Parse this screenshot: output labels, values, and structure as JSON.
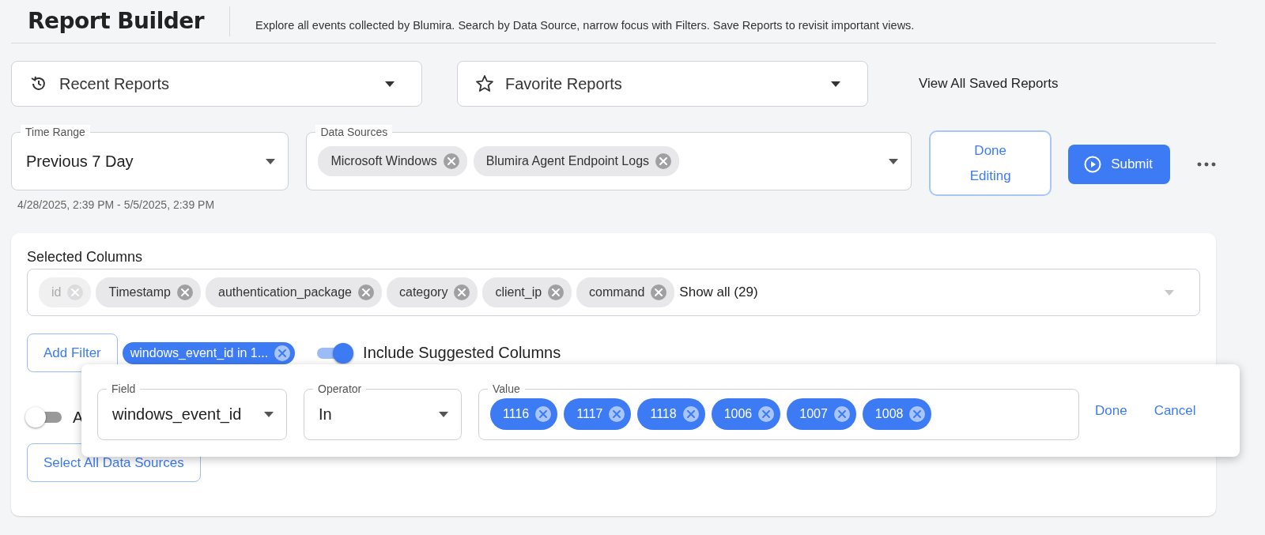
{
  "header": {
    "title": "Report Builder",
    "description": "Explore all events collected by Blumira. Search by Data Source, narrow focus with Filters. Save Reports to revisit important views."
  },
  "saved_reports": {
    "recent": "Recent Reports",
    "favorite": "Favorite Reports",
    "view_all": "View All Saved Reports"
  },
  "time_range": {
    "label": "Time Range",
    "value": "Previous 7 Day",
    "range_text": "4/28/2025, 2:39 PM - 5/5/2025, 2:39 PM"
  },
  "data_sources": {
    "label": "Data Sources",
    "chips": [
      "Microsoft Windows",
      "Blumira Agent Endpoint Logs"
    ]
  },
  "buttons": {
    "done_editing": "Done Editing",
    "submit": "Submit"
  },
  "selected_columns": {
    "label": "Selected Columns",
    "chips": [
      {
        "label": "id",
        "disabled": true
      },
      {
        "label": "Timestamp",
        "disabled": false
      },
      {
        "label": "authentication_package",
        "disabled": false
      },
      {
        "label": "category",
        "disabled": false
      },
      {
        "label": "client_ip",
        "disabled": false
      },
      {
        "label": "command",
        "disabled": false
      }
    ],
    "show_all": "Show all (29)"
  },
  "add_filter": "Add Filter",
  "filters": [
    "windows_event_id in 1..."
  ],
  "toggles": [
    {
      "label": "Include Suggested Columns",
      "on": true
    },
    {
      "label": "A",
      "on": false
    }
  ],
  "select_all": "Select All Data Sources",
  "filter_editor": {
    "field": {
      "label": "Field",
      "value": "windows_event_id"
    },
    "operator": {
      "label": "Operator",
      "value": "In"
    },
    "value": {
      "label": "Value",
      "chips": [
        "1116",
        "1117",
        "1118",
        "1006",
        "1007",
        "1008"
      ]
    },
    "done": "Done",
    "cancel": "Cancel"
  }
}
